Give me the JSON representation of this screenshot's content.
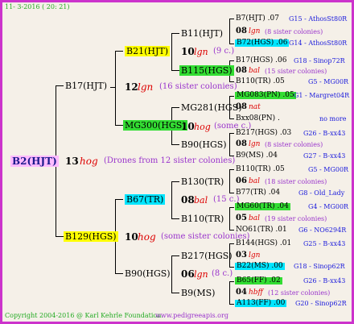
{
  "header": "11-  3-2016 ( 20: 21)",
  "footer": {
    "copyright": "Copyright 2004-2016 @ Karl Kehrle Foundation.",
    "site": "www.pedigreeapis.org"
  },
  "colors": {
    "yellow": "#ffff00",
    "cyan": "#00e5ff",
    "green": "#33dd33",
    "magenta": "#ffbbff",
    "frame": "#cc33cc"
  },
  "root": {
    "name": "B2(HJT)",
    "num": "13",
    "mark": "hog",
    "note": "(Drones from 12 sister colonies)"
  },
  "g1": [
    {
      "name": "B17(HJT)",
      "num": "12",
      "mark": "lgn",
      "note": "(16 sister colonies)"
    },
    {
      "name": "B129(HGS)",
      "num": "10",
      "mark": "hog",
      "note": "(some sister colonies)"
    }
  ],
  "g2": [
    {
      "name": "B21(HJT)",
      "num": "10",
      "mark": "lgn",
      "note": "(9 c.)"
    },
    {
      "name": "MG300(HGS)",
      "num": "10",
      "mark": "hog",
      "note": "(some c.)"
    },
    {
      "name": "B67(TR)",
      "num": "08",
      "mark": "bal",
      "note": "(15 c.)"
    },
    {
      "name": "B90(HGS)",
      "num": "06",
      "mark": "lgn",
      "note": "(8 c.)"
    }
  ],
  "g3": [
    {
      "name": "B11(HJT)",
      "num": "10",
      "mark": "lgn",
      "note": "(9 c.)"
    },
    {
      "name": "B115(HGS)",
      "num": "",
      "mark": "",
      "note": ""
    },
    {
      "name": "MG281(HGS)",
      "num": "",
      "mark": "",
      "note": ""
    },
    {
      "name": "B90(HGS)",
      "num": "",
      "mark": "",
      "note": ""
    },
    {
      "name": "B130(TR)",
      "num": "",
      "mark": "",
      "note": ""
    },
    {
      "name": "B110(TR)",
      "num": "",
      "mark": "",
      "note": ""
    },
    {
      "name": "B217(HGS)",
      "num": "",
      "mark": "",
      "note": ""
    },
    {
      "name": "B9(MS)",
      "num": "",
      "mark": "",
      "note": ""
    }
  ],
  "g4": [
    {
      "name": "B7(HJT) .07",
      "code": "G15 - AthosSt80R"
    },
    {
      "num": "08",
      "mark": "lgn",
      "note": "(8 sister colonies)"
    },
    {
      "name": "B72(HGS) .06",
      "code": "G14 - AthosSt80R"
    },
    {
      "name": "B17(HGS) .06",
      "code": "G18 - Sinop72R"
    },
    {
      "num": "08",
      "mark": "bal",
      "note": "(15 sister colonies)"
    },
    {
      "name": "B110(TR) .05",
      "code": "G5 - MG00R"
    },
    {
      "name": "MG083(PN) .05",
      "code": "G1 - Margret04R"
    },
    {
      "num": "08",
      "mark": "nat",
      "note": ""
    },
    {
      "name": "Bxx08(PN) .",
      "code": "no more"
    },
    {
      "name": "B217(HGS) .03",
      "code": "G26 - B-xx43"
    },
    {
      "num": "08",
      "mark": "lgn",
      "note": "(8 sister colonies)"
    },
    {
      "name": "B9(MS) .04",
      "code": "G27 - B-xx43"
    },
    {
      "name": "B110(TR) .05",
      "code": "G5 - MG00R"
    },
    {
      "num": "06",
      "mark": "bal",
      "note": "(18 sister colonies)"
    },
    {
      "name": "B77(TR) .04",
      "code": "G8 - Old_Lady"
    },
    {
      "name": "MG60(TR) .04",
      "code": "G4 - MG00R"
    },
    {
      "num": "05",
      "mark": "bal",
      "note": "(19 sister colonies)"
    },
    {
      "name": "NO61(TR) .01",
      "code": "G6 - NO6294R"
    },
    {
      "name": "B144(HGS) .01",
      "code": "G25 - B-xx43"
    },
    {
      "num": "03",
      "mark": "lgn",
      "note": ""
    },
    {
      "name": "B22(MS) .00",
      "code": "G18 - Sinop62R"
    },
    {
      "name": "B65(FF) .02",
      "code": "G26 - B-xx43"
    },
    {
      "num": "04",
      "mark": "hbff",
      "note": "(12 sister colonies)"
    },
    {
      "name": "A113(FF) .00",
      "code": "G20 - Sinop62R"
    }
  ]
}
